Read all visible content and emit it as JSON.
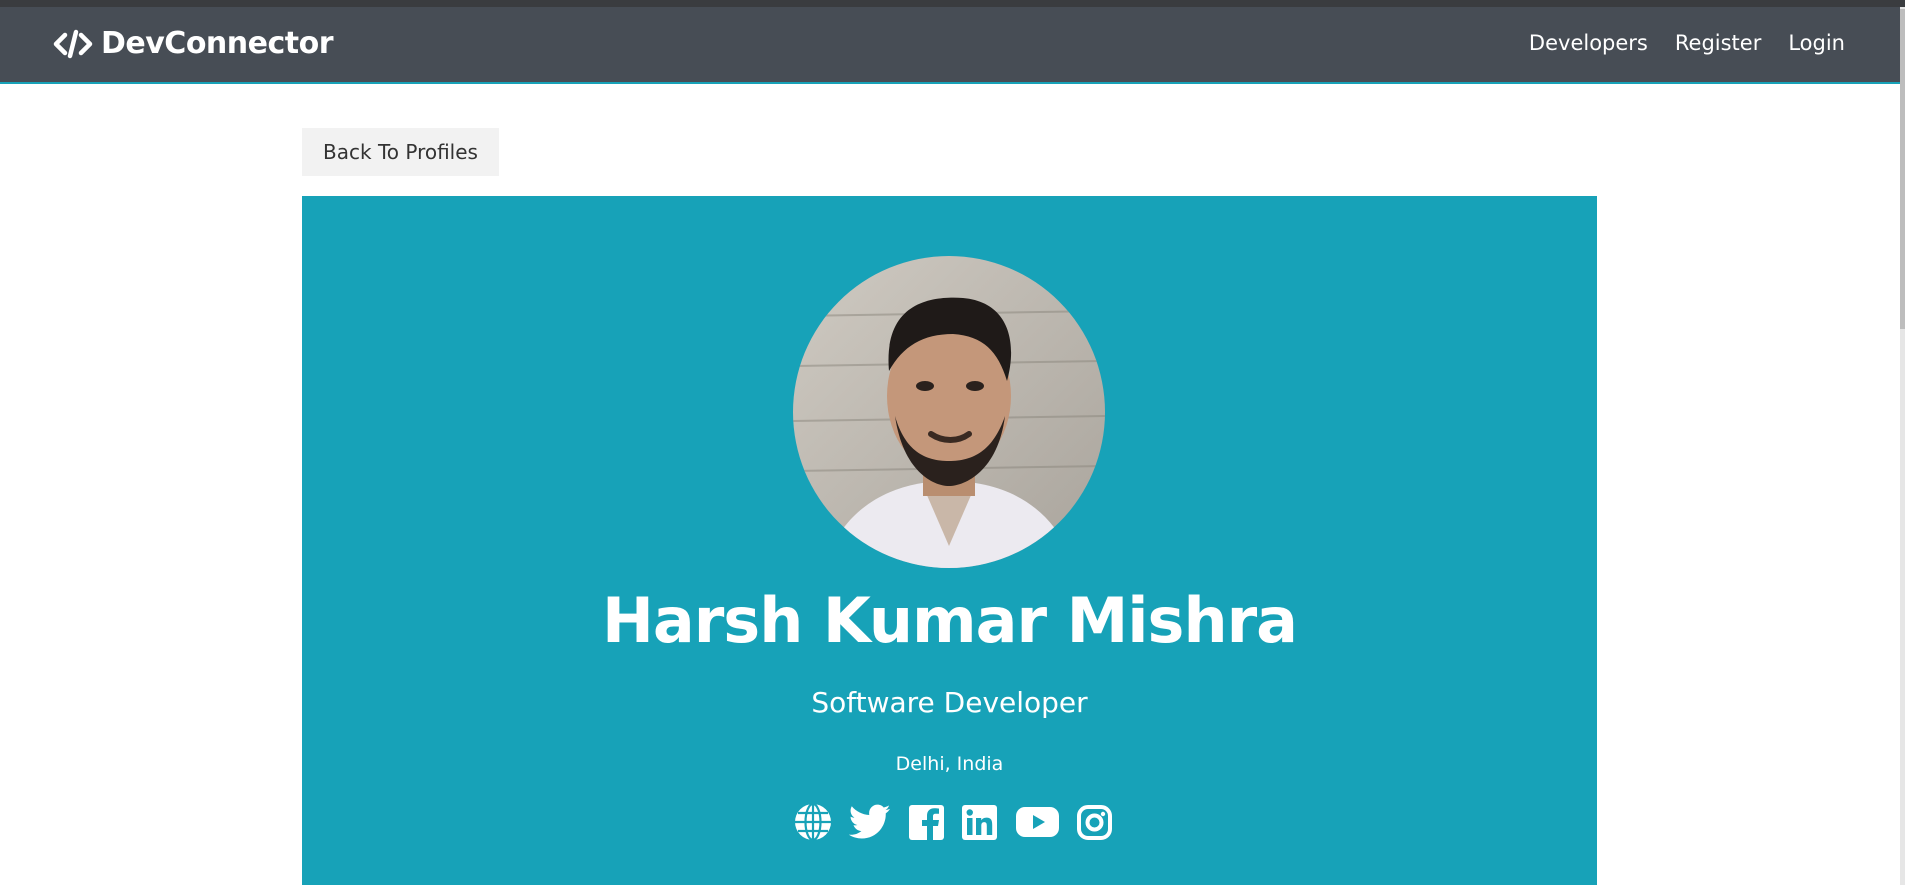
{
  "navbar": {
    "brand": "DevConnector",
    "links": [
      {
        "label": "Developers"
      },
      {
        "label": "Register"
      },
      {
        "label": "Login"
      }
    ]
  },
  "back_button": {
    "label": "Back To Profiles"
  },
  "profile": {
    "name": "Harsh Kumar Mishra",
    "status": "Software Developer",
    "location": "Delhi, India",
    "avatar": "profile-photo",
    "social_icons": [
      "globe-icon",
      "twitter-icon",
      "facebook-icon",
      "linkedin-icon",
      "youtube-icon",
      "instagram-icon"
    ]
  },
  "colors": {
    "navbar_bg": "#474d55",
    "primary": "#17a2b8",
    "light": "#f2f2f2"
  }
}
